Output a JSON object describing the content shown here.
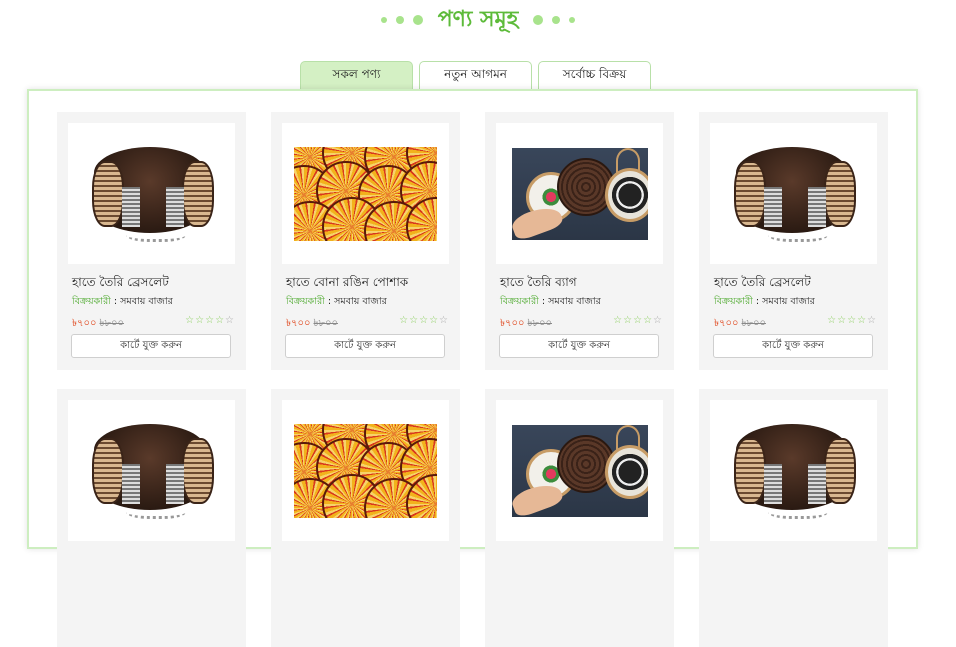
{
  "section": {
    "title": "পণ্য সমূহ"
  },
  "tabs": [
    {
      "label": "সকল পণ্য",
      "active": true
    },
    {
      "label": "নতুন আগমন",
      "active": false
    },
    {
      "label": "সর্বোচ্চ বিক্রয়",
      "active": false
    }
  ],
  "seller_label": "বিক্রয়কারী",
  "cart_label": "কার্টে যুক্ত করুন",
  "products": [
    {
      "name": "হাতে তৈরি ব্রেসলেট",
      "seller": "সমবায় বাজার",
      "price": "৳৭০০",
      "old_price": "৳৮০০",
      "rating": 0,
      "image": "bracelet"
    },
    {
      "name": "হাতে বোনা রঙিন পোশাক",
      "seller": "সমবায় বাজার",
      "price": "৳৭০০",
      "old_price": "৳৮০০",
      "rating": 0,
      "image": "fans"
    },
    {
      "name": "হাতে তৈরি ব্যাগ",
      "seller": "সমবায় বাজার",
      "price": "৳৭০০",
      "old_price": "৳৮০০",
      "rating": 0,
      "image": "bags"
    },
    {
      "name": "হাতে তৈরি ব্রেসলেট",
      "seller": "সমবায় বাজার",
      "price": "৳৭০০",
      "old_price": "৳৮০০",
      "rating": 0,
      "image": "bracelet"
    },
    {
      "image": "bracelet"
    },
    {
      "image": "fans"
    },
    {
      "image": "bags"
    },
    {
      "image": "bracelet"
    }
  ],
  "colors": {
    "accent": "#5dbb3a",
    "price": "#e0481e",
    "tab_active": "#d4f0c4",
    "panel_border": "#cdeec0"
  },
  "icons": {
    "star": "star-outline-icon"
  }
}
